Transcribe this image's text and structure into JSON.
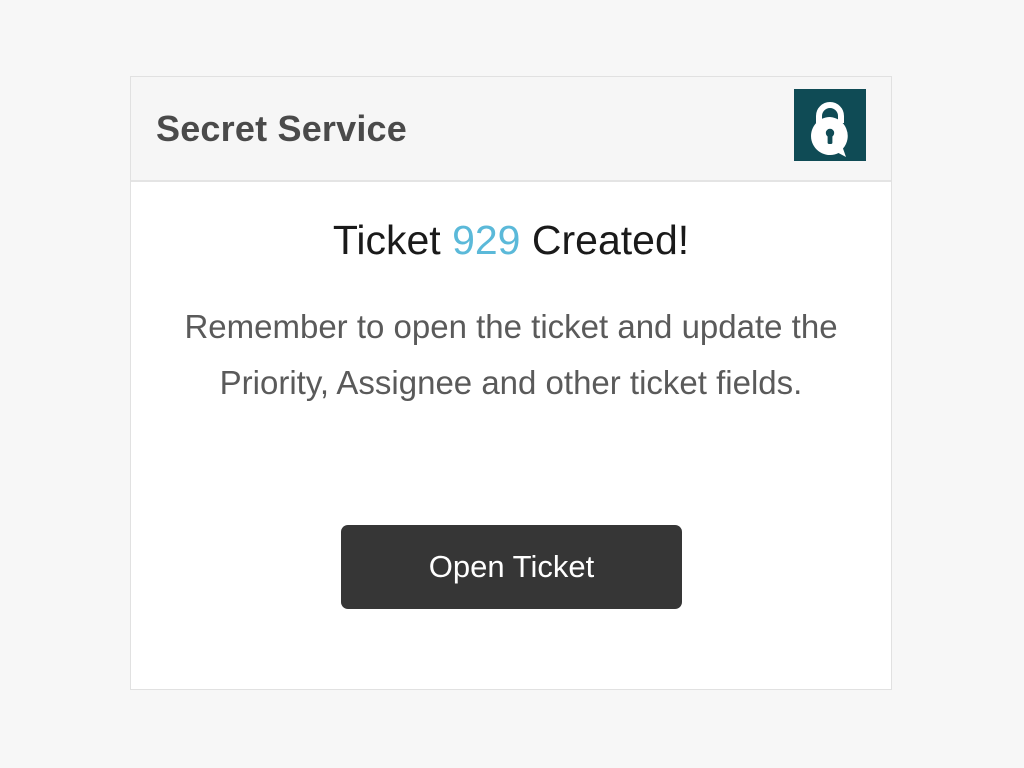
{
  "header": {
    "app_title": "Secret Service",
    "logo_icon": "lock-chat-icon",
    "logo_bg_color": "#0f4b55"
  },
  "confirmation": {
    "headline_prefix": "Ticket",
    "ticket_number": "929",
    "headline_suffix": "Created!",
    "message": "Remember to open the ticket and update the Priority, Assignee and other ticket fields.",
    "number_color": "#5bb9d9"
  },
  "actions": {
    "open_ticket_label": "Open Ticket"
  }
}
